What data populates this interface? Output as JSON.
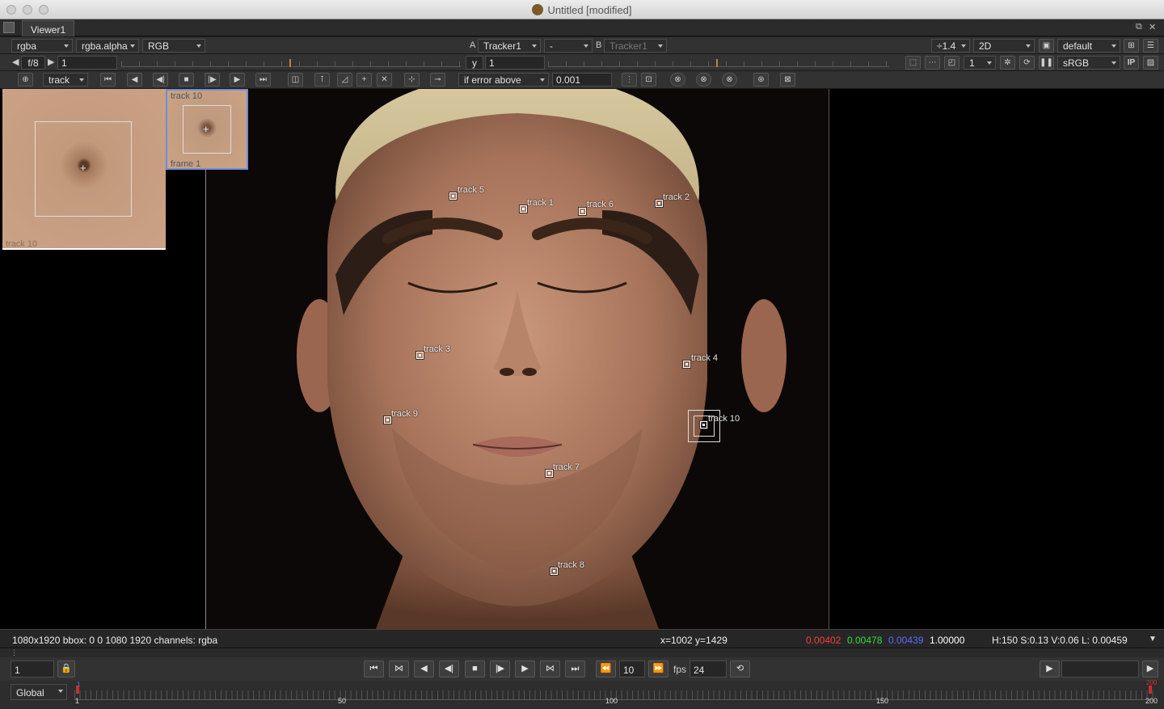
{
  "window": {
    "title": "Untitled [modified]"
  },
  "tab": {
    "label": "Viewer1"
  },
  "toolbar1": {
    "channels": "rgba",
    "alpha_channel": "rgba.alpha",
    "colorspace_display": "RGB",
    "a_label": "A",
    "a_input": "Tracker1",
    "composite_op": "-",
    "b_label": "B",
    "b_input": "Tracker1",
    "zoom": "÷1.4",
    "view_mode": "2D",
    "lut": "default"
  },
  "toolbar2": {
    "fstop": "f/8",
    "gain": "1",
    "y_label": "y",
    "gamma": "1",
    "proxy": "1",
    "viewer_colorspace": "sRGB",
    "ip_label": "IP"
  },
  "toolbar3": {
    "mode": "track",
    "error_mode": "if error above",
    "error_threshold": "0.001"
  },
  "zoom_windows": {
    "main_label": "track 10",
    "pattern_label": "track 10",
    "frame_label": "frame 1"
  },
  "tracks": [
    {
      "label": "track 5"
    },
    {
      "label": "track 1"
    },
    {
      "label": "track 6"
    },
    {
      "label": "track 2"
    },
    {
      "label": "track 3"
    },
    {
      "label": "track 4"
    },
    {
      "label": "track 9"
    },
    {
      "label": "track 10"
    },
    {
      "label": "track 7"
    },
    {
      "label": "track 8"
    }
  ],
  "status": {
    "format": "1080x1920 bbox: 0 0 1080 1920 channels: rgba",
    "coords": "x=1002 y=1429",
    "r": "0.00402",
    "g": "0.00478",
    "b": "0.00439",
    "a": "1.00000",
    "hsv": "H:150 S:0.13 V:0.06  L: 0.00459",
    "colors": {
      "r": "#ff3b3b",
      "g": "#3bdb3b",
      "b": "#5a6cff",
      "a": "#ffffff"
    }
  },
  "playback": {
    "current_frame": "1",
    "skip": "10",
    "fps_label": "fps",
    "fps": "24",
    "global": "Global"
  },
  "timeline": {
    "ticks": [
      "1",
      "50",
      "100",
      "150",
      "200"
    ],
    "current_marker": "1",
    "end_marker": "200"
  }
}
